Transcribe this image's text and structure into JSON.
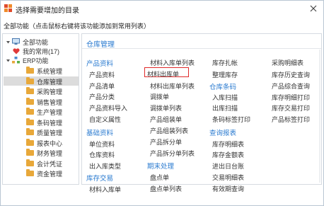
{
  "window": {
    "title": "选择需要增加的目录",
    "close_icon": "close-icon"
  },
  "hint": "全部功能（点击鼠标右键将该功能添加到常用列表）",
  "tree": {
    "root": "全部功能",
    "favorites": "我的常用(17)",
    "erp": "ERP功能",
    "items": [
      "系统管理",
      "仓库管理",
      "采购管理",
      "销售管理",
      "生产管理",
      "条码管理",
      "质量管理",
      "报表中心",
      "财务管理",
      "会计凭证",
      "资金管理"
    ]
  },
  "panel": {
    "title": "仓库管理",
    "col1": {
      "cat1": "产品资料",
      "cat1_items": [
        "产品资料",
        "产品清单",
        "产品分类",
        "产品资料导入",
        "自定义属性"
      ],
      "cat2": "基础资料",
      "cat2_items": [
        "单位资料",
        "仓库资料",
        "出入库类型"
      ],
      "cat3": "库存交易",
      "cat3_items": [
        "材料入库单"
      ]
    },
    "col2": {
      "items": [
        "材料入库单列表",
        "材料出库单",
        "材料出库单列表",
        "调拨单",
        "调拨单列表",
        "产品组装单",
        "产品组装列表",
        "产品拆分单",
        "产品拆分单列表"
      ],
      "cat": "期末处理",
      "cat_items": [
        "盘点单",
        "盘点单列表"
      ]
    },
    "col3": {
      "items": [
        "库存扎帐",
        "整理库存"
      ],
      "cat1": "仓库条码",
      "cat1_items": [
        "入库扫描",
        "出库扫描",
        "条码标签打印"
      ],
      "cat2": "查询报表",
      "cat2_items": [
        "库存明细表",
        "库存金额表",
        "进出日台账",
        "交易明细表",
        "有效期查询"
      ]
    },
    "col4": {
      "items": [
        "采购明细表",
        "库存历史查询",
        "产品综合查询",
        "库存明细打印",
        "库存交易打印",
        "产品标签打印"
      ]
    }
  }
}
